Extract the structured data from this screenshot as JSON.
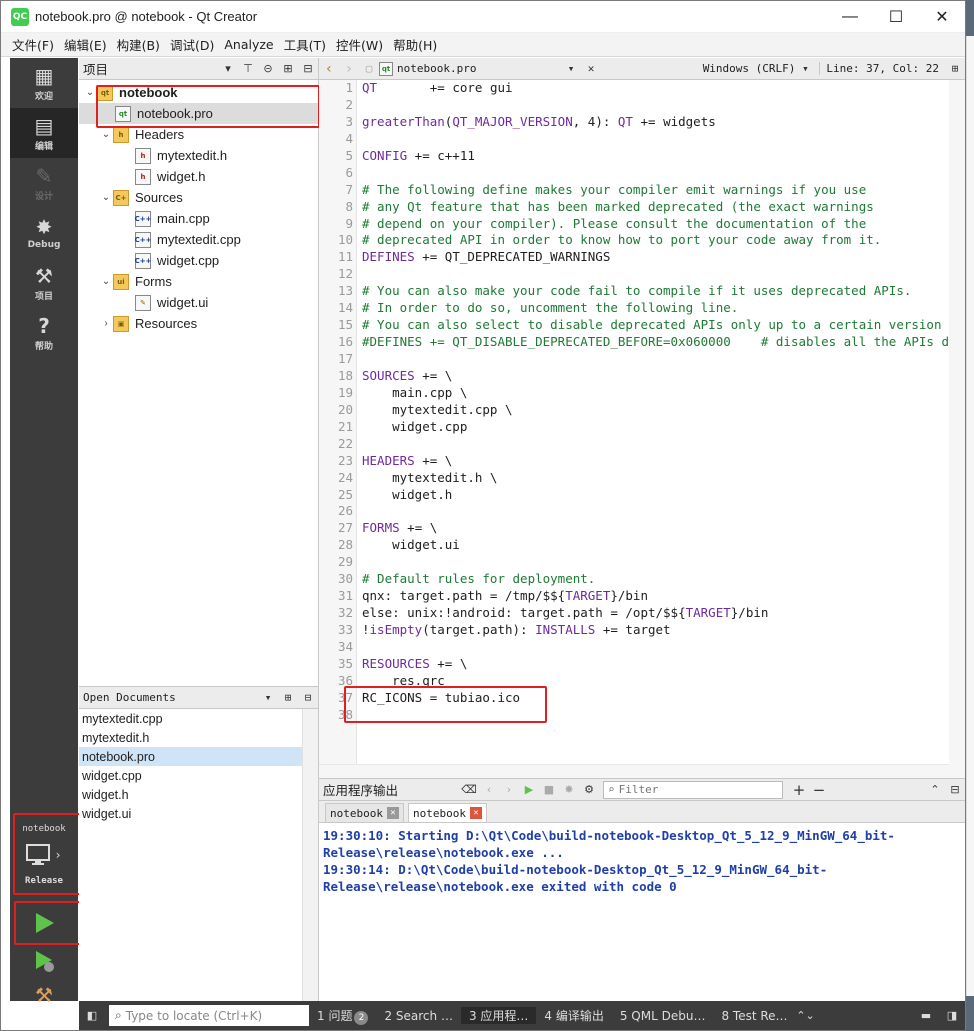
{
  "window": {
    "app_icon": "QC",
    "title": "notebook.pro @ notebook - Qt Creator",
    "minimize": "—",
    "maximize": "☐",
    "close": "✕"
  },
  "menu": [
    "文件(F)",
    "编辑(E)",
    "构建(B)",
    "调试(D)",
    "Analyze",
    "工具(T)",
    "控件(W)",
    "帮助(H)"
  ],
  "modes": [
    {
      "label": "欢迎",
      "icon": "grid-icon",
      "glyph": "▦"
    },
    {
      "label": "编辑",
      "icon": "edit-doc-icon",
      "glyph": "▤"
    },
    {
      "label": "设计",
      "icon": "pencil-icon",
      "glyph": "✎"
    },
    {
      "label": "Debug",
      "icon": "bug-icon",
      "glyph": "✸"
    },
    {
      "label": "项目",
      "icon": "wrench-icon",
      "glyph": "⚒"
    },
    {
      "label": "帮助",
      "icon": "help-icon",
      "glyph": "?"
    }
  ],
  "kit": {
    "project": "notebook",
    "build": "Release",
    "arrow": "›"
  },
  "project_pane": {
    "title": "项目",
    "tree": {
      "root": "notebook",
      "pro_file": "notebook.pro",
      "headers_label": "Headers",
      "headers": [
        "mytextedit.h",
        "widget.h"
      ],
      "sources_label": "Sources",
      "sources": [
        "main.cpp",
        "mytextedit.cpp",
        "widget.cpp"
      ],
      "forms_label": "Forms",
      "forms": [
        "widget.ui"
      ],
      "resources_label": "Resources"
    }
  },
  "open_documents": {
    "title": "Open Documents",
    "items": [
      "mytextedit.cpp",
      "mytextedit.h",
      "notebook.pro",
      "widget.cpp",
      "widget.h",
      "widget.ui"
    ]
  },
  "editor": {
    "file": "notebook.pro",
    "line_ending": "Windows (CRLF)",
    "position": "Line: 37, Col: 22",
    "line_numbers": [
      "1",
      "2",
      "3",
      "4",
      "5",
      "6",
      "7",
      "8",
      "9",
      "10",
      "11",
      "12",
      "13",
      "14",
      "15",
      "16",
      "17",
      "18",
      "19",
      "20",
      "21",
      "22",
      "23",
      "24",
      "25",
      "26",
      "27",
      "28",
      "29",
      "30",
      "31",
      "32",
      "33",
      "34",
      "35",
      "36",
      "37",
      "38"
    ]
  },
  "output": {
    "title": "应用程序输出",
    "filter_placeholder": "Filter",
    "tabs": [
      "notebook",
      "notebook"
    ],
    "lines": [
      "19:30:10: Starting D:\\Qt\\Code\\build-notebook-Desktop_Qt_5_12_9_MinGW_64_bit-",
      "Release\\release\\notebook.exe ...",
      "19:30:14: D:\\Qt\\Code\\build-notebook-Desktop_Qt_5_12_9_MinGW_64_bit-",
      "Release\\release\\notebook.exe exited with code 0"
    ]
  },
  "statusbar": {
    "locate_placeholder": "Type to locate (Ctrl+K)",
    "items": [
      "1 问题",
      "2 Search …",
      "3 应用程… ",
      "4 编译输出",
      "5 QML Debu…",
      "8 Test Re…"
    ],
    "issues_badge": "2"
  }
}
